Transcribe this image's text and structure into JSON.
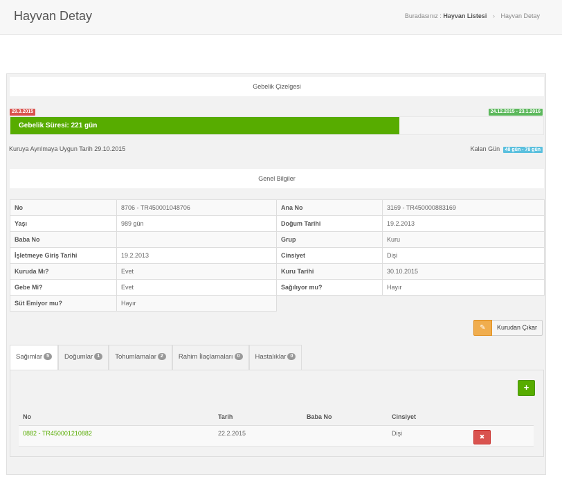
{
  "header": {
    "title": "Hayvan Detay",
    "breadcrumb_prefix": "Buradasınız :",
    "breadcrumb_link": "Hayvan Listesi",
    "breadcrumb_separator": "›",
    "breadcrumb_current": "Hayvan Detay"
  },
  "pregnancy": {
    "section_title": "Gebelik Çizelgesi",
    "start_date": "29.3.2015",
    "end_range": "24.12.2015 - 23.1.2016",
    "progress_fraction": 0.73,
    "progress_label": "Gebelik Süresi: 221 gün",
    "dry_note": "Kuruya Ayrılmaya Uygun Tarih 29.10.2015",
    "remaining_label": "Kalan Gün",
    "remaining_value": "48 gün - 78 gün"
  },
  "general": {
    "section_title": "Genel Bilgiler",
    "rows": [
      [
        {
          "k": "No",
          "v": "8706 - TR450001048706"
        },
        {
          "k": "Ana No",
          "v": "3169 - TR450000883169",
          "link": true
        }
      ],
      [
        {
          "k": "Yaşı",
          "v": "989 gün"
        },
        {
          "k": "Doğum Tarihi",
          "v": "19.2.2013"
        }
      ],
      [
        {
          "k": "Baba No",
          "v": ""
        },
        {
          "k": "Grup",
          "v": "Kuru"
        }
      ],
      [
        {
          "k": "İşletmeye Giriş Tarihi",
          "v": "19.2.2013"
        },
        {
          "k": "Cinsiyet",
          "v": "Dişi"
        }
      ],
      [
        {
          "k": "Kuruda Mı?",
          "v": "Evet"
        },
        {
          "k": "Kuru Tarihi",
          "v": "30.10.2015"
        }
      ],
      [
        {
          "k": "Gebe Mi?",
          "v": "Evet"
        },
        {
          "k": "Sağılıyor mu?",
          "v": "Hayır"
        }
      ],
      [
        {
          "k": "Süt Emiyor mu?",
          "v": "Hayır"
        }
      ]
    ]
  },
  "actions": {
    "dry_button_icon": "edit-icon",
    "dry_button_label": "Kurudan Çıkar"
  },
  "tabs": [
    {
      "label": "Sağımlar",
      "count": "5",
      "active": true
    },
    {
      "label": "Doğumlar",
      "count": "1"
    },
    {
      "label": "Tohumlamalar",
      "count": "2"
    },
    {
      "label": "Rahim İlaçlamaları",
      "count": "0"
    },
    {
      "label": "Hastalıklar",
      "count": "0"
    }
  ],
  "births": {
    "add_icon": "plus-icon",
    "add_symbol": "+",
    "columns": [
      "No",
      "Tarih",
      "Baba No",
      "Cinsiyet"
    ],
    "rows": [
      {
        "no": "0882 - TR450001210882",
        "tarih": "22.2.2015",
        "baba_no": "",
        "cinsiyet": "Dişi"
      }
    ],
    "delete_icon": "close-icon",
    "delete_symbol": "✖"
  },
  "colors": {
    "primary_green": "#57ac00",
    "danger_red": "#d9534f",
    "success_green": "#5cb85c",
    "info_blue": "#5bc0de",
    "warning_orange": "#f0ad4e"
  }
}
